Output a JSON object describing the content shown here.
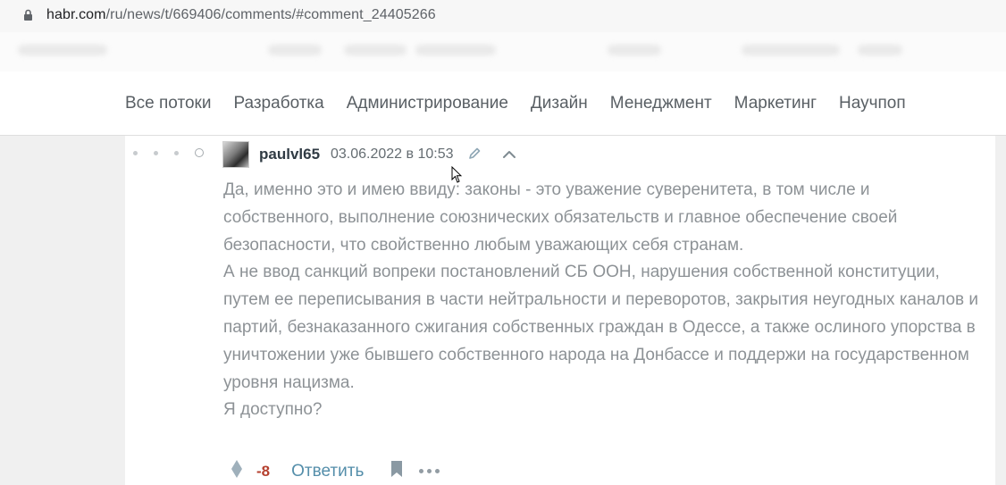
{
  "browser": {
    "url_host": "habr.com",
    "url_path": "/ru/news/t/669406/comments/#comment_24405266"
  },
  "nav": {
    "flows": [
      "Все потоки",
      "Разработка",
      "Администрирование",
      "Дизайн",
      "Менеджмент",
      "Маркетинг",
      "Научпоп"
    ]
  },
  "comment": {
    "author": "paulvl65",
    "datetime": "03.06.2022 в 10:53",
    "paragraphs": [
      "Да, именно это и имею ввиду: законы - это уважение суверенитета, в том числе и собственного, выполнение союзнических обязательств и главное обеспечение своей безопасности, что свойственно любым уважающих себя странам.",
      "А не ввод санкций вопреки постановлений СБ ООН, нарушения собственной конституции, путем ее переписывания в части нейтральности и переворотов, закрытия неугодных каналов и партий, безнаказанного сжигания собственных граждан в Одессе, а также ослиного упорства в уничтожении уже бывшего собственного народа на Донбассе и поддержи на государственном уровня нацизма.",
      "Я доступно?"
    ],
    "score": "-8",
    "reply_label": "Ответить"
  },
  "icons": {
    "lock": "lock-icon",
    "edit": "pencil-icon",
    "collapse": "chevron-up-icon",
    "karma": "karma-drop-icon",
    "bookmark": "bookmark-icon",
    "more": "more-dots-icon"
  },
  "colors": {
    "score_negative": "#b5402f",
    "link": "#548eaa",
    "comment_text": "#8d9296"
  }
}
